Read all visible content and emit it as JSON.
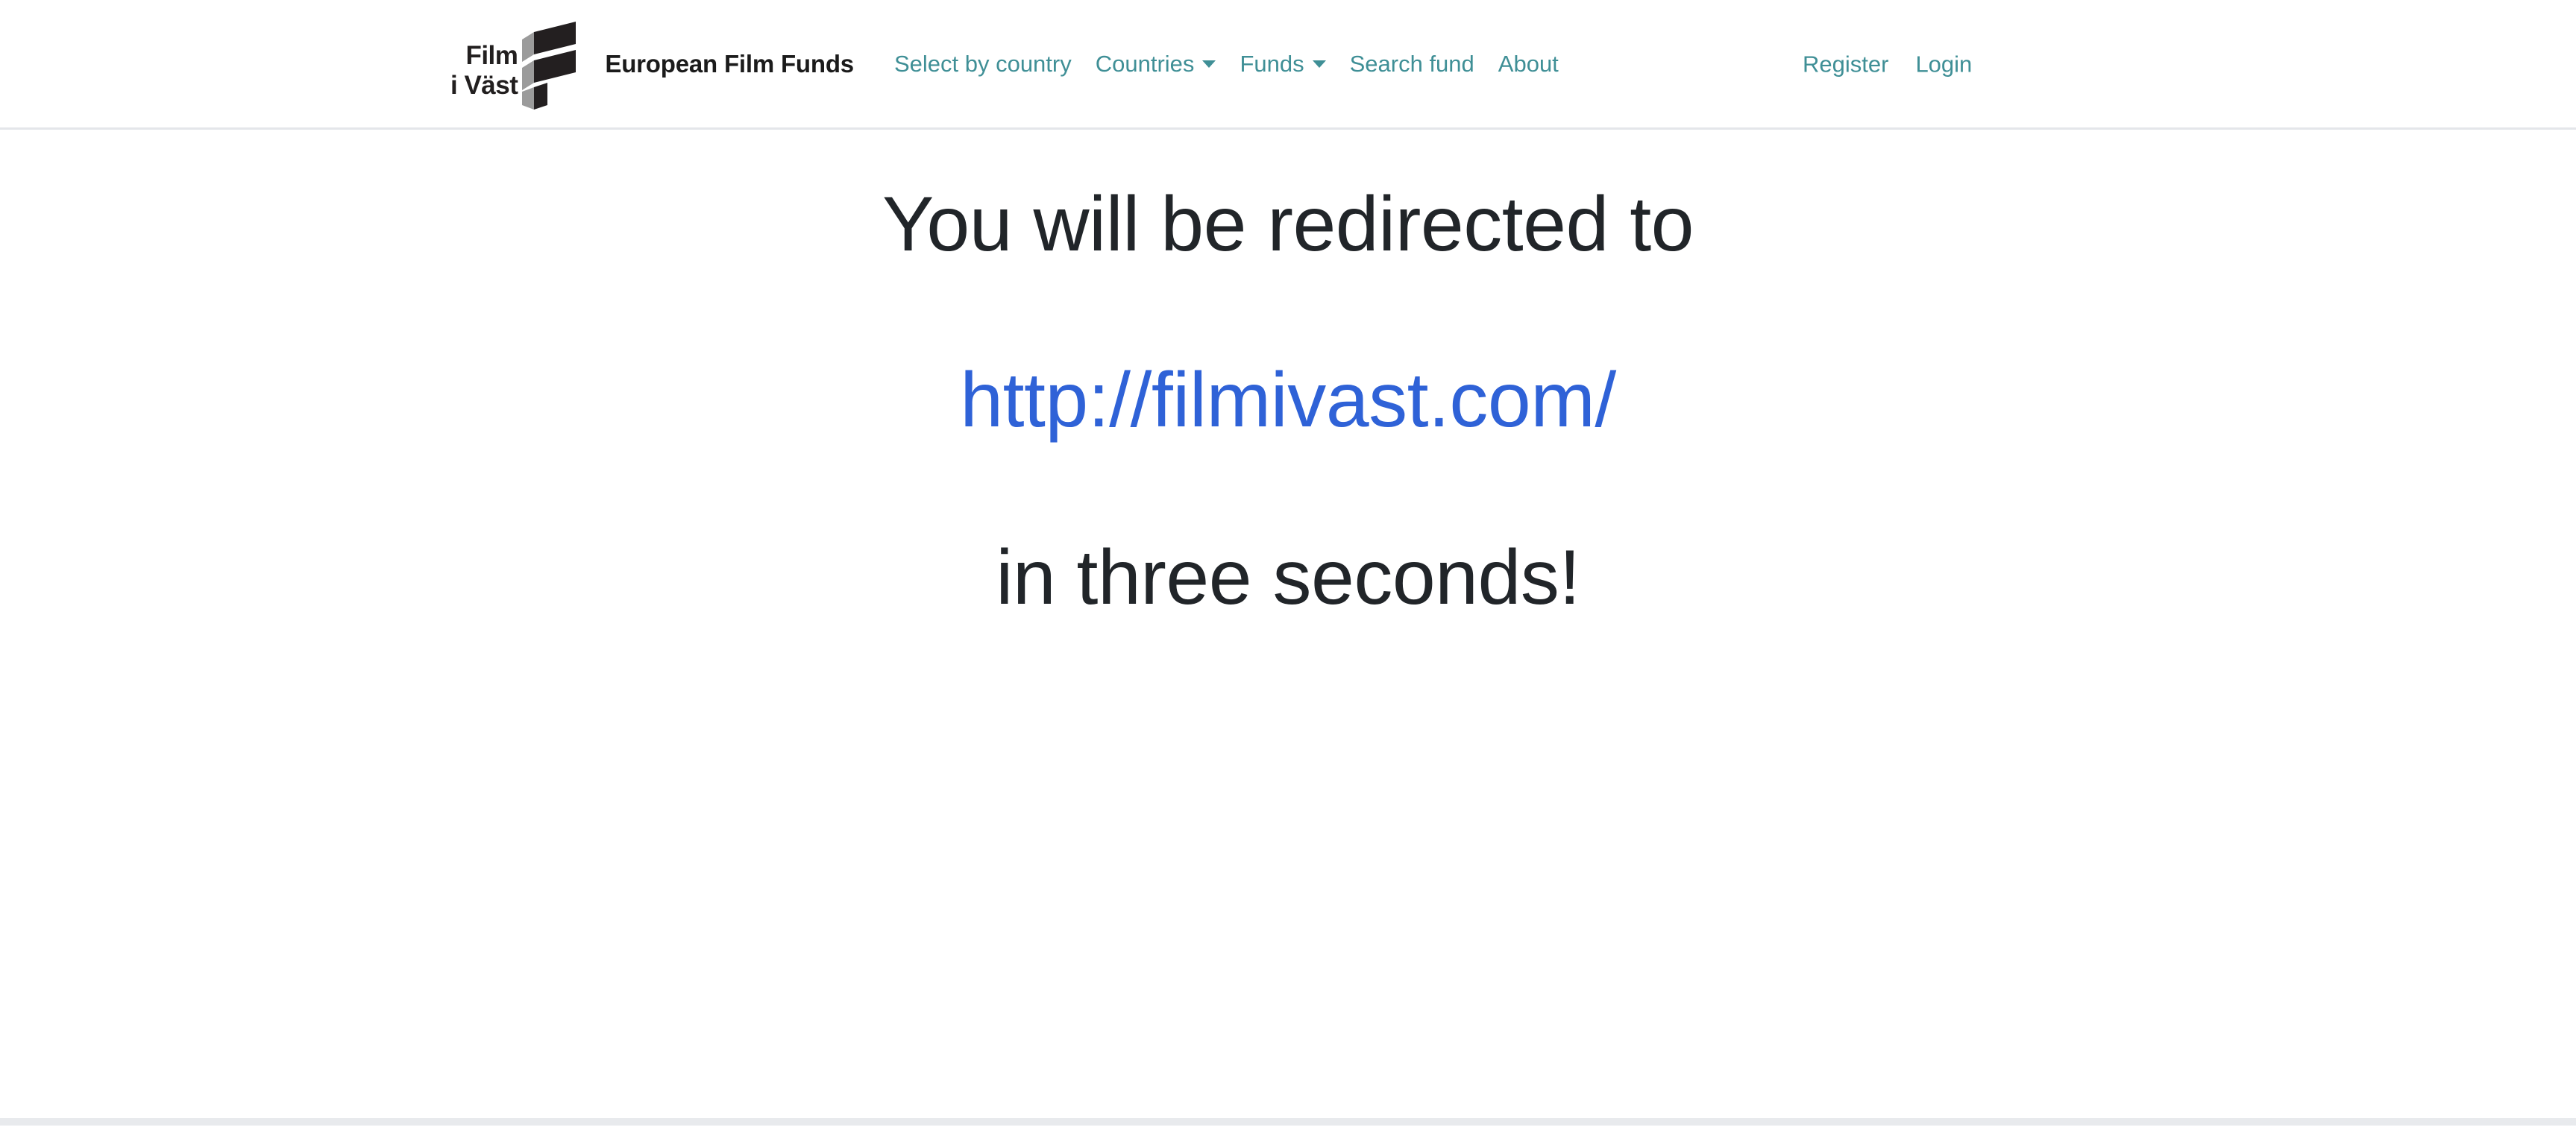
{
  "header": {
    "logo": {
      "line1": "Film",
      "line2": "i Väst",
      "icon": "film-i-vast-chevrons-icon"
    },
    "brand_title": "European Film Funds",
    "nav_left": [
      {
        "label": "Select by country",
        "has_caret": false
      },
      {
        "label": "Countries",
        "has_caret": true
      },
      {
        "label": "Funds",
        "has_caret": true
      },
      {
        "label": "Search fund",
        "has_caret": false
      },
      {
        "label": "About",
        "has_caret": false
      }
    ],
    "nav_right": [
      {
        "label": "Register"
      },
      {
        "label": "Login"
      }
    ]
  },
  "main": {
    "line_1": "You will be redirected to",
    "redirect_url": "http://filmivast.com/",
    "line_3": "in three seconds!"
  },
  "colors": {
    "nav_link": "#3f8f96",
    "link_blue": "#2f62d7",
    "text_dark": "#212529",
    "footer_bar": "#e8eaed",
    "header_border": "#e4e6ea"
  }
}
